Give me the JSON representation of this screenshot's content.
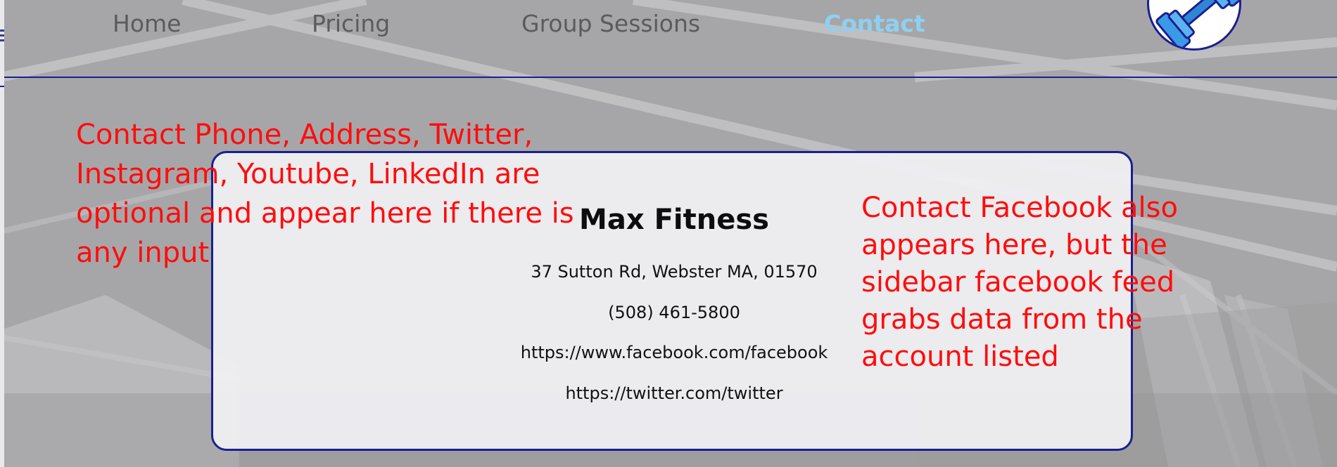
{
  "nav": {
    "items": [
      {
        "label": "Home",
        "active": false
      },
      {
        "label": "Pricing",
        "active": false
      },
      {
        "label": "Group Sessions",
        "active": false
      },
      {
        "label": "Contact",
        "active": true
      }
    ],
    "logo_icon": "dumbbell-icon"
  },
  "contact_card": {
    "business_name": "Max Fitness",
    "address": "37 Sutton Rd, Webster MA, 01570",
    "phone": "(508) 461-5800",
    "facebook": "https://www.facebook.com/facebook",
    "twitter": "https://twitter.com/twitter"
  },
  "annotations": {
    "left": "Contact Phone, Address, Twitter, Instagram, Youtube, LinkedIn are optional and appear here if there is any input",
    "right": "Contact Facebook also appears here, but the sidebar facebook feed grabs data from the account listed"
  },
  "colors": {
    "nav_text": "#5b5b5e",
    "nav_active": "#8fd0f0",
    "accent_rule": "#1b1f8f",
    "annotation": "#ff0d0d",
    "card_bg": "#f0f0f3"
  }
}
